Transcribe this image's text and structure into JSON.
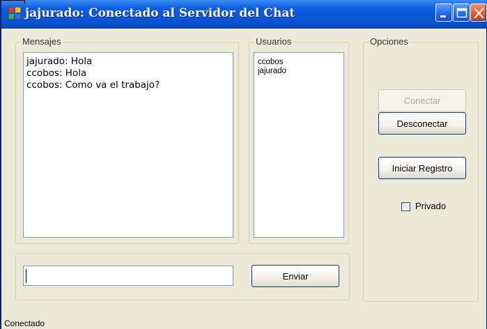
{
  "window": {
    "title": "jajurado: Conectado al Servidor del Chat",
    "colors": {
      "titlebar": "#0a55d7",
      "face": "#ece9d8"
    }
  },
  "messages": {
    "label": "Mensajes",
    "items": [
      "jajurado: Hola",
      "ccobos: Hola",
      "ccobos: Como va el trabajo?"
    ]
  },
  "users": {
    "label": "Usuarios",
    "items": [
      "ccobos",
      "jajurado"
    ]
  },
  "options": {
    "label": "Opciones",
    "connect_label": "Conectar",
    "disconnect_label": "Desconectar",
    "log_label": "Iniciar Registro",
    "private_label": "Privado",
    "private_checked": false
  },
  "compose": {
    "input_value": "",
    "send_label": "Enviar"
  },
  "status": {
    "text": "Conectado"
  }
}
